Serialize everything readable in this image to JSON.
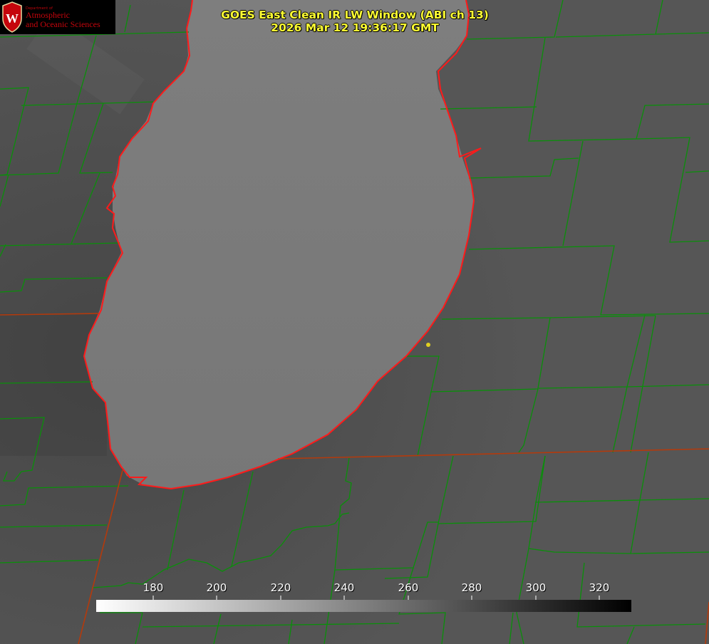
{
  "title_line1": "GOES East Clean IR LW Window (ABI ch 13)",
  "title_line2": "2026 Mar 12 19:36:17 GMT",
  "logo": {
    "department": "Department of",
    "line1": "Atmospheric",
    "line2": "and Oceanic Sciences",
    "shield_letter": "W"
  },
  "colorbar": {
    "ticks": [
      "180",
      "200",
      "220",
      "240",
      "260",
      "280",
      "300",
      "320"
    ],
    "gradient_start": "#ffffff",
    "gradient_end": "#000000"
  },
  "colors": {
    "land": "#505050",
    "lake": "#7a7a7a",
    "county_lines": "#00b000",
    "state_lines": "#b03010",
    "shoreline": "#ff2020",
    "marker": "#e0d020",
    "title": "#ffff33"
  }
}
